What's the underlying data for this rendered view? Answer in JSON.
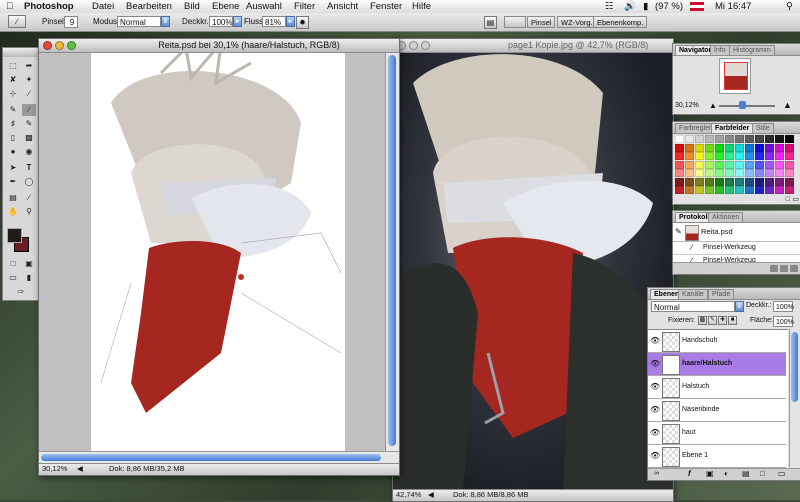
{
  "menubar": {
    "app": "Photoshop",
    "menus": [
      "Datei",
      "Bearbeiten",
      "Bild",
      "Ebene",
      "Auswahl",
      "Filter",
      "Ansicht",
      "Fenster",
      "Hilfe"
    ],
    "battery": "(97 %)",
    "clock": "Mi 16:47"
  },
  "options": {
    "brush_label": "Pinsel:",
    "brush_size": "9",
    "mode_label": "Modus:",
    "mode_value": "Normal",
    "opacity_label": "Deckkr.:",
    "opacity_value": "100%",
    "flow_label": "Fluss:",
    "flow_value": "81%",
    "well_tabs": [
      "Pinsel",
      "WZ-Vorg.",
      "Ebenenkomp."
    ]
  },
  "doc1": {
    "title": "Reita.psd bei 30,1% (haare/Halstuch, RGB/8)",
    "zoom": "30,12%",
    "doc_info": "Dok: 8,86 MB/35,2 MB"
  },
  "doc2": {
    "title": "page1 Kopie.jpg @ 42,7% (RGB/8)",
    "zoom": "42,74%",
    "doc_info": "Dok: 8,86 MB/8,86 MB"
  },
  "navigator": {
    "tabs": [
      "Navigator",
      "Info",
      "Histogramm"
    ],
    "zoom": "30,12%",
    "slider_level": 0.4
  },
  "swatches": {
    "tabs": [
      "Farbregler",
      "Farbfelder",
      "Stile"
    ]
  },
  "history": {
    "tabs": [
      "Protokoll",
      "Aktionen"
    ],
    "snapshot": "Reita.psd",
    "steps": [
      "Pinsel-Werkzeug",
      "Pinsel-Werkzeug"
    ]
  },
  "layers": {
    "tabs": [
      "Ebenen",
      "Kanäle",
      "Pfade"
    ],
    "blend_mode": "Normal",
    "opacity_label": "Deckkr.:",
    "opacity_value": "100%",
    "lock_label": "Fixieren:",
    "fill_label": "Fläche:",
    "fill_value": "100%",
    "items": [
      {
        "name": "Handschuh",
        "selected": false
      },
      {
        "name": "haare/Halstuch",
        "selected": true
      },
      {
        "name": "Halstuch",
        "selected": false
      },
      {
        "name": "Nasenbinde",
        "selected": false
      },
      {
        "name": "haut",
        "selected": false
      },
      {
        "name": "Ebene 1",
        "selected": false
      }
    ]
  },
  "colors": {
    "foreground": "#231a1c",
    "background": "#6b1f22",
    "selection": "#a97be6",
    "scarf": "#b8322a"
  }
}
